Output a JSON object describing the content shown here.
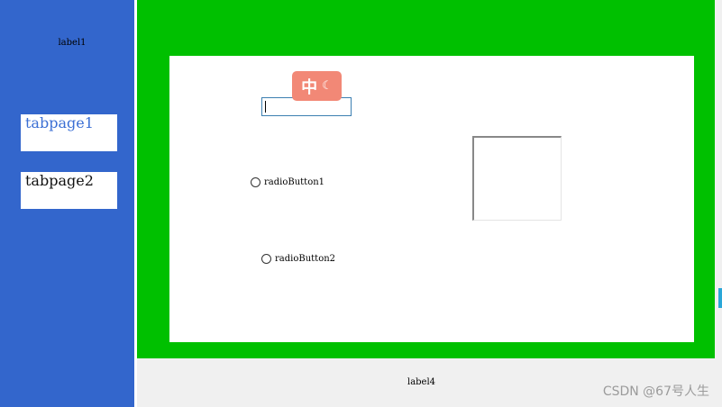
{
  "sidebar": {
    "label": "label1",
    "tabs": [
      {
        "label": "tabpage1"
      },
      {
        "label": "tabpage2"
      }
    ]
  },
  "main": {
    "text_input": {
      "value": ""
    },
    "ime": {
      "char": "中",
      "icon": "moon-icon"
    },
    "radios": [
      {
        "label": "radioButton1"
      },
      {
        "label": "radioButton2"
      }
    ]
  },
  "footer": {
    "label": "label4"
  },
  "watermark": "CSDN @67号人生",
  "colors": {
    "sidebar": "#3366cc",
    "panel": "#00c000",
    "ime_badge": "#f28876",
    "tab_selected_text": "#3b6fd4"
  }
}
